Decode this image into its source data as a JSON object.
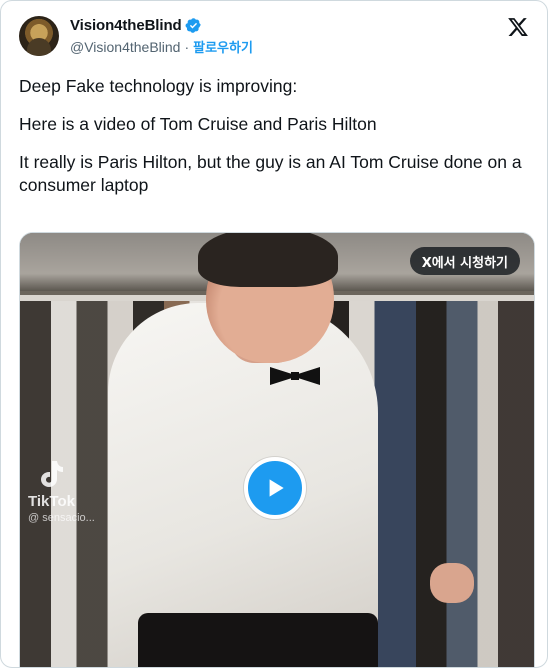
{
  "author": {
    "display_name": "Vision4theBlind",
    "handle": "@Vision4theBlind",
    "separator": "·",
    "follow_label": "팔로우하기",
    "verified": true,
    "avatar_icon": "avatar-image"
  },
  "brand": {
    "logo_icon": "x-logo-icon"
  },
  "tweet": {
    "line1": "Deep Fake technology is improving:",
    "line2": "Here is a video of Tom Cruise and Paris Hilton",
    "line3": "It really is Paris Hilton, but the guy is an AI Tom Cruise done on a consumer laptop"
  },
  "media": {
    "watch_on_x_label": "X에서 시청하기",
    "play_icon": "play-icon",
    "watermark_brand": "TikTok",
    "watermark_handle": "@ sensacio..."
  },
  "colors": {
    "accent": "#1d9bf0",
    "text": "#0f1419",
    "secondary_text": "#536471"
  }
}
